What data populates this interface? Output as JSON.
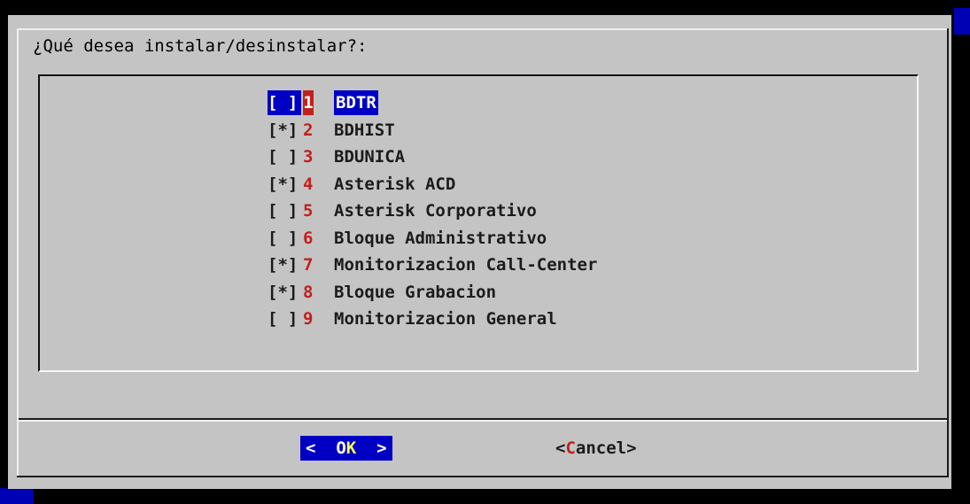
{
  "dialog": {
    "prompt": "¿Qué desea instalar/desinstalar?:"
  },
  "items": [
    {
      "check": "[ ]",
      "num": "1",
      "label": "BDTR",
      "selected": true
    },
    {
      "check": "[*]",
      "num": "2",
      "label": "BDHIST",
      "selected": false
    },
    {
      "check": "[ ]",
      "num": "3",
      "label": "BDUNICA",
      "selected": false
    },
    {
      "check": "[*]",
      "num": "4",
      "label": "Asterisk ACD",
      "selected": false
    },
    {
      "check": "[ ]",
      "num": "5",
      "label": "Asterisk Corporativo",
      "selected": false
    },
    {
      "check": "[ ]",
      "num": "6",
      "label": "Bloque Administrativo",
      "selected": false
    },
    {
      "check": "[*]",
      "num": "7",
      "label": "Monitorizacion Call-Center",
      "selected": false
    },
    {
      "check": "[*]",
      "num": "8",
      "label": "Bloque Grabacion",
      "selected": false
    },
    {
      "check": "[ ]",
      "num": "9",
      "label": "Monitorizacion General",
      "selected": false
    }
  ],
  "buttons": {
    "ok": {
      "left": "<  ",
      "pre": "O",
      "hot": "K",
      "right": "  >"
    },
    "cancel": {
      "left": "<",
      "hot": "C",
      "rest": "ancel>"
    }
  },
  "colors": {
    "dialog_bg": "#c4c4c4",
    "selection_bg": "#0000c4",
    "hotkey_red": "#c2201c",
    "hotkey_yellow": "#ffff55",
    "screen_bg": "#000000"
  }
}
